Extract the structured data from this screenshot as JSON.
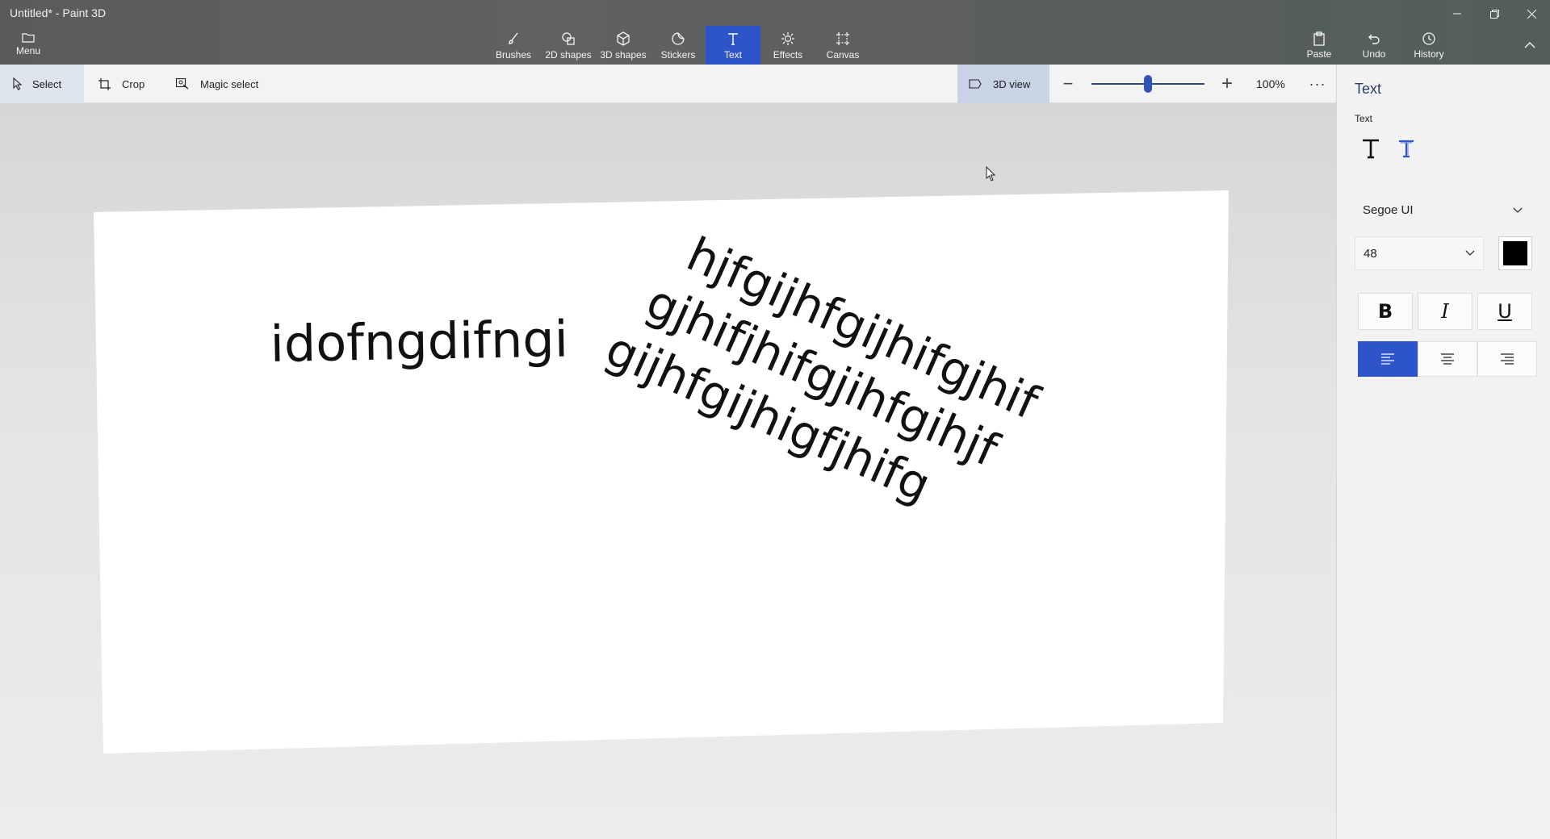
{
  "window": {
    "title": "Untitled* - Paint 3D",
    "minimize_icon": "minimize-icon",
    "restore_icon": "restore-icon",
    "close_icon": "close-icon"
  },
  "ribbon": {
    "menu_label": "Menu",
    "tools": [
      {
        "label": "Brushes",
        "icon": "brush-icon"
      },
      {
        "label": "2D shapes",
        "icon": "2d-shapes-icon"
      },
      {
        "label": "3D shapes",
        "icon": "3d-shapes-icon"
      },
      {
        "label": "Stickers",
        "icon": "stickers-icon"
      },
      {
        "label": "Text",
        "icon": "text-icon",
        "active": true
      },
      {
        "label": "Effects",
        "icon": "effects-icon"
      },
      {
        "label": "Canvas",
        "icon": "canvas-icon"
      }
    ],
    "right_tools": [
      {
        "label": "Paste",
        "icon": "paste-icon"
      },
      {
        "label": "Undo",
        "icon": "undo-icon"
      },
      {
        "label": "History",
        "icon": "history-icon"
      }
    ],
    "active_color": "#2e54c9"
  },
  "subtoolbar": {
    "select_label": "Select",
    "crop_label": "Crop",
    "magic_select_label": "Magic select",
    "view3d_label": "3D view",
    "zoom_percent": "100%",
    "zoom_slider_fraction": 0.5
  },
  "canvas": {
    "text_box_1": "idofngdifngi",
    "text_box_2_lines": [
      "hjfgijhfgijhifgjhif",
      "gjhifjhifgjihfgihjf",
      "gijhfgijhigfjhifg"
    ]
  },
  "panel": {
    "title": "Text",
    "subtitle": "Text",
    "font_family_value": "Segoe UI",
    "font_size_value": "48",
    "text_color": "#000000",
    "bold_label": "B",
    "italic_label": "I",
    "underline_label": "U",
    "alignment": "left"
  }
}
